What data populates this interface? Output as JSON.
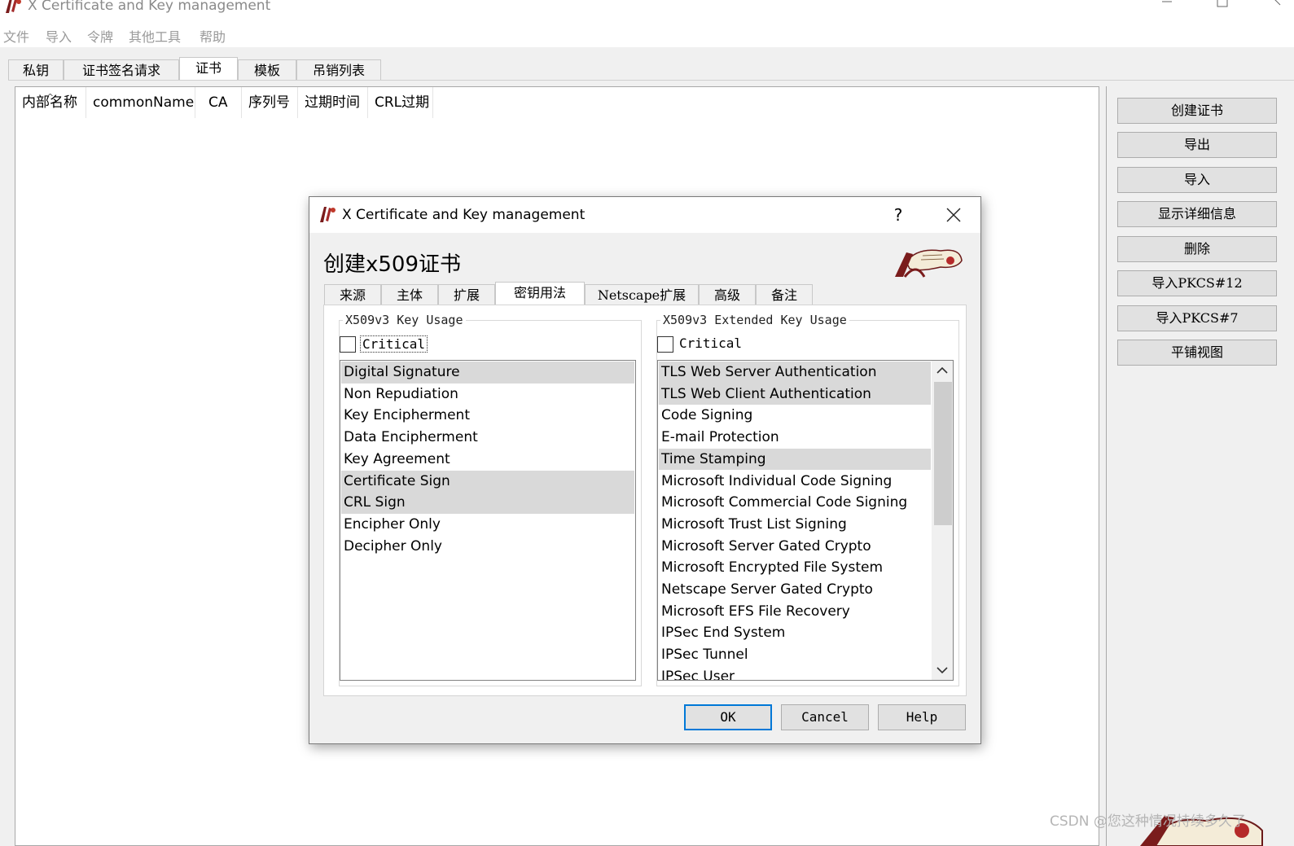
{
  "window": {
    "title": "X Certificate and Key management"
  },
  "menu": [
    "文件",
    "导入",
    "令牌",
    "其他工具",
    "帮助"
  ],
  "main_tabs": [
    {
      "label": "私钥"
    },
    {
      "label": "证书签名请求"
    },
    {
      "label": "证书",
      "active": true
    },
    {
      "label": "模板"
    },
    {
      "label": "吊销列表"
    }
  ],
  "columns": [
    "内部名称",
    "commonName",
    "CA",
    "序列号",
    "过期时间",
    "CRL过期"
  ],
  "side_buttons": [
    "创建证书",
    "导出",
    "导入",
    "显示详细信息",
    "删除",
    "导入PKCS#12",
    "导入PKCS#7",
    "平铺视图"
  ],
  "watermark": "CSDN @您这种情况持续多久了",
  "dialog": {
    "title": "X Certificate and Key management",
    "help_glyph": "?",
    "heading": "创建x509证书",
    "tabs": [
      {
        "label": "来源"
      },
      {
        "label": "主体"
      },
      {
        "label": "扩展"
      },
      {
        "label": "密钥用法",
        "active": true
      },
      {
        "label": "Netscape扩展"
      },
      {
        "label": "高级"
      },
      {
        "label": "备注"
      }
    ],
    "key_usage": {
      "group_label": "X509v3 Key Usage",
      "critical_label": "Critical",
      "critical_checked": false,
      "items": [
        {
          "label": "Digital Signature",
          "selected": true
        },
        {
          "label": "Non Repudiation",
          "selected": false
        },
        {
          "label": "Key Encipherment",
          "selected": false
        },
        {
          "label": "Data Encipherment",
          "selected": false
        },
        {
          "label": "Key Agreement",
          "selected": false
        },
        {
          "label": "Certificate Sign",
          "selected": true
        },
        {
          "label": "CRL Sign",
          "selected": true
        },
        {
          "label": "Encipher Only",
          "selected": false
        },
        {
          "label": "Decipher Only",
          "selected": false
        }
      ]
    },
    "ext_key_usage": {
      "group_label": "X509v3 Extended Key Usage",
      "critical_label": "Critical",
      "critical_checked": false,
      "items": [
        {
          "label": "TLS Web Server Authentication",
          "selected": true
        },
        {
          "label": "TLS Web Client Authentication",
          "selected": true
        },
        {
          "label": "Code Signing",
          "selected": false
        },
        {
          "label": "E-mail Protection",
          "selected": false
        },
        {
          "label": "Time Stamping",
          "selected": true
        },
        {
          "label": "Microsoft Individual Code Signing",
          "selected": false
        },
        {
          "label": "Microsoft Commercial Code Signing",
          "selected": false
        },
        {
          "label": "Microsoft Trust List Signing",
          "selected": false
        },
        {
          "label": "Microsoft Server Gated Crypto",
          "selected": false
        },
        {
          "label": "Microsoft Encrypted File System",
          "selected": false
        },
        {
          "label": "Netscape Server Gated Crypto",
          "selected": false
        },
        {
          "label": "Microsoft EFS File Recovery",
          "selected": false
        },
        {
          "label": "IPSec End System",
          "selected": false
        },
        {
          "label": "IPSec Tunnel",
          "selected": false
        },
        {
          "label": "IPSec User",
          "selected": false
        }
      ]
    },
    "buttons": {
      "ok": "OK",
      "cancel": "Cancel",
      "help": "Help"
    }
  },
  "colors": {
    "selection": "#d9d9d9",
    "default_button_border": "#0078d7",
    "window_bg": "#f0f0f0"
  }
}
